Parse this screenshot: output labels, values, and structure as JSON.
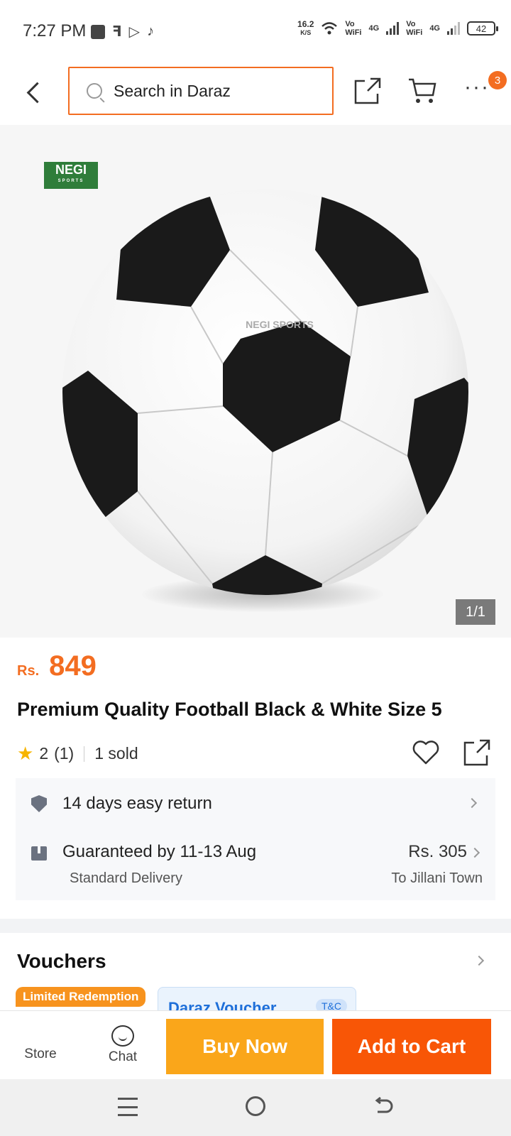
{
  "status_bar": {
    "time": "7:27 PM",
    "speed_value": "16.2",
    "speed_unit": "K/S",
    "sim1_label_top": "Vo",
    "sim1_label_bottom": "WiFi",
    "sim1_net": "4G",
    "sim2_label_top": "Vo",
    "sim2_label_bottom": "WiFi",
    "sim2_net": "4G",
    "battery": "42"
  },
  "header": {
    "search_placeholder": "Search in Daraz",
    "cart_badge": "3"
  },
  "product_image": {
    "brand_logo_text": "NEGI",
    "brand_logo_sub": "SPORTS",
    "ball_print": "NEGI SPORTS",
    "counter": "1/1"
  },
  "product": {
    "currency": "Rs.",
    "price": "849",
    "title": "Premium Quality Football Black & White Size 5",
    "rating": "2",
    "rating_count": "(1)",
    "sold": "1 sold"
  },
  "delivery": {
    "return_text": "14 days easy return",
    "guarantee_text": "Guaranteed by 11-13 Aug",
    "delivery_type": "Standard Delivery",
    "delivery_price": "Rs. 305",
    "destination": "To Jillani Town"
  },
  "vouchers": {
    "title": "Vouchers",
    "tag": "Limited Redemption",
    "voucher_name": "Daraz Voucher",
    "tc": "T&C"
  },
  "action_bar": {
    "store_label": "Store",
    "chat_label": "Chat",
    "buy_now": "Buy Now",
    "add_to_cart": "Add to Cart"
  },
  "colors": {
    "accent": "#f36d21",
    "buy_now": "#faa61a",
    "add_to_cart": "#f85606"
  }
}
